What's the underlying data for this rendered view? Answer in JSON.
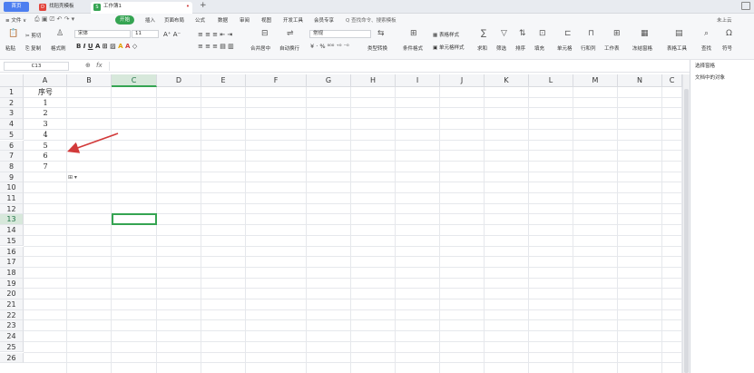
{
  "titlebar": {
    "home_label": "首页",
    "tabs": [
      {
        "label": "找稻壳模板",
        "icon_text": "D",
        "color": "#e2433b"
      },
      {
        "label": "工作簿1",
        "icon_text": "S",
        "color": "#35a452"
      }
    ],
    "add_tab": "+"
  },
  "menu": {
    "file_label": "≡ 文件 ∨",
    "start_label": "开始",
    "items": [
      "插入",
      "页面布局",
      "公式",
      "数据",
      "审阅",
      "视图",
      "开发工具",
      "会员专享"
    ],
    "search_label": "Q 查找命令、搜索模板",
    "right_label": "未上云"
  },
  "ribbon": {
    "paste": "粘贴",
    "cut": "剪切",
    "copy": "复制",
    "format_painter": "格式刷",
    "font_name": "宋体",
    "font_size": "11",
    "merge": "合并居中",
    "wrap": "自动换行",
    "number_format": "常规",
    "type_convert": "类型转换",
    "cond_format": "条件格式",
    "table_style": "表格样式",
    "cell_style": "单元格样式",
    "sum": "求和",
    "filter": "筛选",
    "sort": "排序",
    "fill": "填充",
    "cell": "单元格",
    "row_col": "行和列",
    "worksheet": "工作表",
    "freeze": "冻结窗格",
    "table_tools": "表格工具",
    "find": "查找",
    "symbol": "符号"
  },
  "formula_bar": {
    "name_box": "C13",
    "fx_label": "fx",
    "zoom_icon": "⊕"
  },
  "right_panel": {
    "title": "选择窗格",
    "subtitle": "文档中的对象"
  },
  "sheet": {
    "columns": [
      "A",
      "B",
      "C",
      "D",
      "E",
      "F",
      "G",
      "H",
      "I",
      "J",
      "K",
      "L",
      "M",
      "N",
      "C"
    ],
    "selected_column": "C",
    "selected_row": "13",
    "rows": [
      "1",
      "2",
      "3",
      "4",
      "5",
      "6",
      "7",
      "8",
      "9",
      "10",
      "11",
      "12",
      "13",
      "14",
      "15",
      "16",
      "17",
      "18",
      "19",
      "20",
      "21",
      "22",
      "23",
      "24",
      "25",
      "26"
    ],
    "colA_values": [
      "序号",
      "1",
      "2",
      "3",
      "4",
      "5",
      "6",
      "7"
    ],
    "paste_option": "⊞ ▾"
  },
  "colors": {
    "accent": "#35a452",
    "arrow": "#d23a3a"
  }
}
